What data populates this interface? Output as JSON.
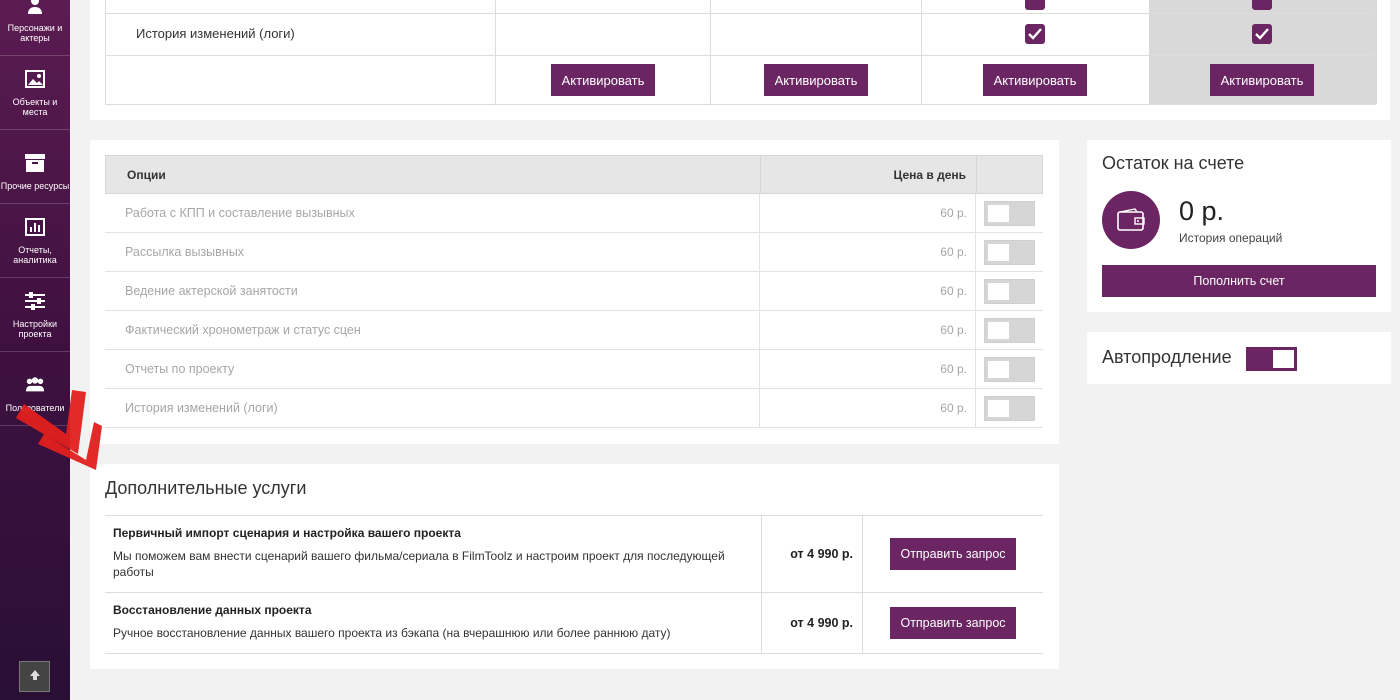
{
  "sidebar": {
    "items": [
      {
        "label": "Персонажи и актеры",
        "icon": "users-icon"
      },
      {
        "label": "Объекты и места",
        "icon": "image-icon"
      },
      {
        "label": "Прочие ресурсы",
        "icon": "box-icon"
      },
      {
        "label": "Отчеты, аналитика",
        "icon": "chart-icon"
      },
      {
        "label": "Настройки проекта",
        "icon": "sliders-icon"
      },
      {
        "label": "Пользователи",
        "icon": "group-icon"
      }
    ]
  },
  "plans": {
    "row_logs_label": "История изменений (логи)",
    "activate_label": "Активировать"
  },
  "options": {
    "header_name": "Опции",
    "header_price": "Цена в день",
    "rows": [
      {
        "name": "Работа с КПП и составление вызывных",
        "price": "60 р."
      },
      {
        "name": "Рассылка вызывных",
        "price": "60 р."
      },
      {
        "name": "Ведение актерской занятости",
        "price": "60 р."
      },
      {
        "name": "Фактический хронометраж и статус сцен",
        "price": "60 р."
      },
      {
        "name": "Отчеты по проекту",
        "price": "60 р."
      },
      {
        "name": "История изменений (логи)",
        "price": "60 р."
      }
    ]
  },
  "services": {
    "title": "Дополнительные услуги",
    "items": [
      {
        "name": "Первичный импорт сценария и настройка вашего проекта",
        "desc": "Мы поможем вам внести сценарий вашего фильма/сериала в FilmToolz и настроим проект для последующей работы",
        "price": "от 4 990 р.",
        "button": "Отправить запрос"
      },
      {
        "name": "Восстановление данных проекта",
        "desc": "Ручное восстановление данных вашего проекта из бэкапа (на вчерашнюю или более раннюю дату)",
        "price": "от 4 990 р.",
        "button": "Отправить запрос"
      }
    ]
  },
  "balance": {
    "title": "Остаток на счете",
    "amount": "0 р.",
    "history_link": "История операций",
    "topup_button": "Пополнить счет"
  },
  "autorenew": {
    "label": "Автопродление",
    "enabled": true
  },
  "colors": {
    "accent": "#6b2563",
    "sidebar_top": "#5b1c52",
    "sidebar_bottom": "#2a0f35"
  }
}
